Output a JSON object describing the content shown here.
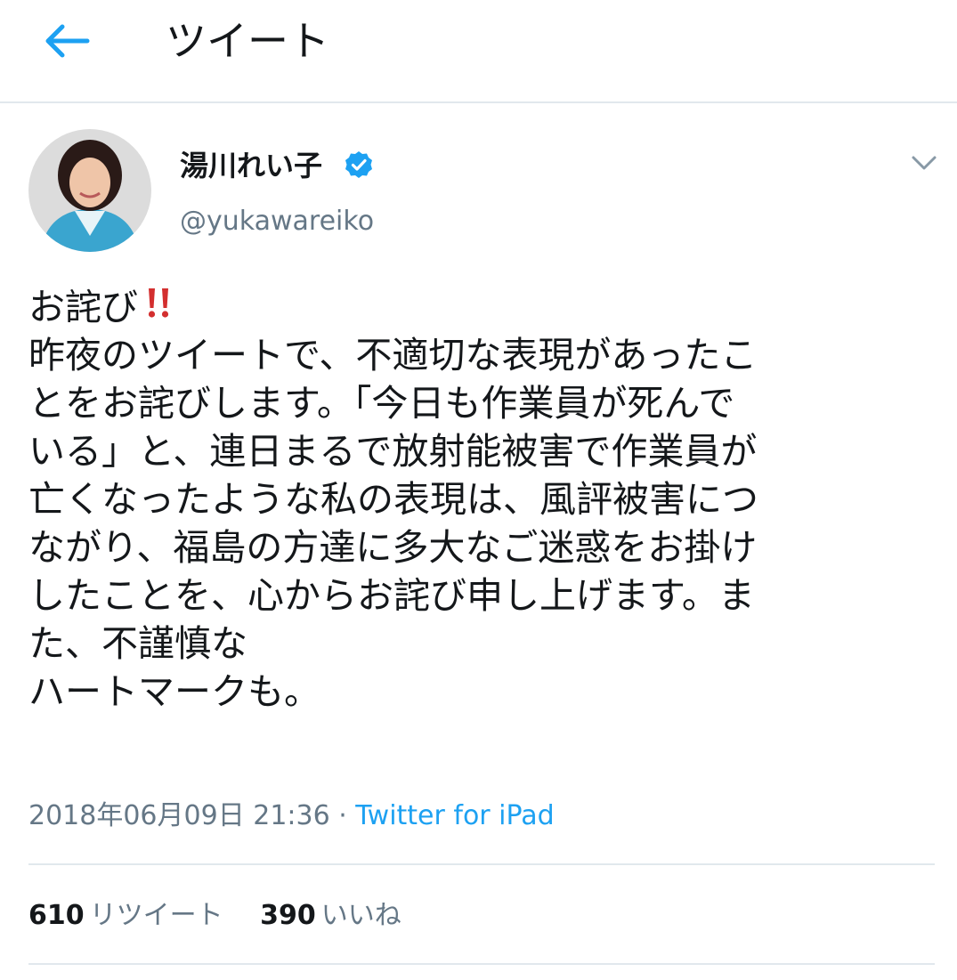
{
  "header": {
    "title": "ツイート",
    "back_icon": "arrow-left-icon"
  },
  "tweet": {
    "author": {
      "name": "湯川れい子",
      "handle": "@yukawareiko",
      "verified_icon": "verified-badge-icon",
      "menu_icon": "chevron-down-icon"
    },
    "text_lines": [
      "お詫び",
      "昨夜のツイートで、不適切な表現があったこ",
      "とをお詫びします。「今日も作業員が死んで",
      "いる」と、連日まるで放射能被害で作業員が",
      "亡くなったような私の表現は、風評被害につ",
      "ながり、福島の方達に多大なご迷惑をお掛け",
      "したことを、心からお詫び申し上げます。ま",
      "た、不謹慎な",
      "ハートマークも。"
    ],
    "emoji_after_first_line": "double-exclamation-icon",
    "timestamp": "2018年06月09日 21:36 · ",
    "source": "Twitter for iPad",
    "stats": {
      "retweets_count": "610",
      "retweets_label": "リツイート",
      "likes_count": "390",
      "likes_label": "いいね"
    }
  },
  "colors": {
    "accent": "#1da1f2",
    "text": "#14171a",
    "secondary_text": "#657786",
    "divider": "#e1e8ed",
    "emoji_red": "#d32f2f"
  }
}
